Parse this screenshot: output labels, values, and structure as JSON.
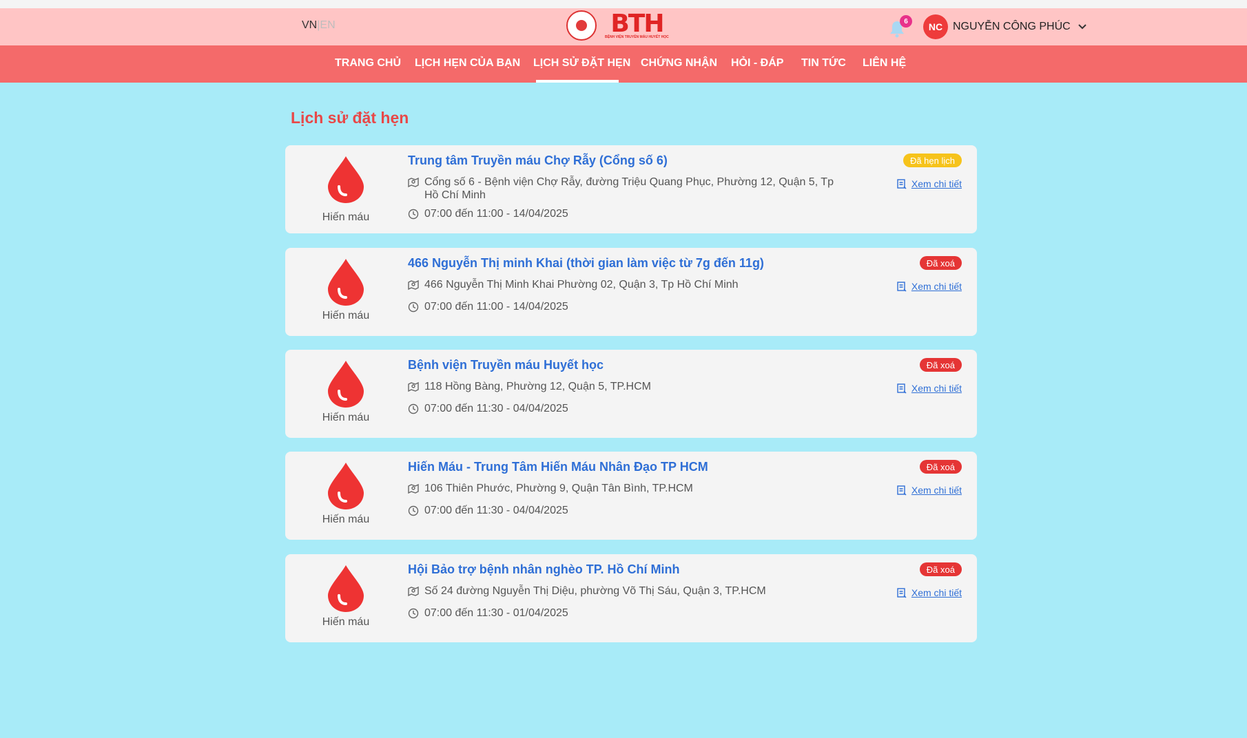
{
  "header": {
    "lang_active": "VN",
    "lang_sep": "|",
    "lang_inactive": "EN",
    "brand": "BTH",
    "brand_sub": "BỆNH VIỆN TRUYỀN MÁU HUYẾT HỌC",
    "notification_count": "6",
    "avatar_initials": "NC",
    "user_name": "NGUYỄN CÔNG PHÚC"
  },
  "nav": {
    "items": [
      "TRANG CHỦ",
      "LỊCH HẸN CỦA BẠN",
      "LỊCH SỬ ĐẶT HẸN",
      "CHỨNG NHẬN",
      "HỎI - ĐÁP",
      "TIN TỨC",
      "LIÊN HỆ"
    ],
    "active": "LỊCH SỬ ĐẶT HẸN"
  },
  "page": {
    "title": "Lịch sử đặt hẹn"
  },
  "appointments": [
    {
      "type_label": "Hiến máu",
      "title": "Trung tâm Truyền máu Chợ Rẫy (Cổng số 6)",
      "address": "Cổng số 6 - Bệnh viện Chợ Rẫy, đường Triệu Quang Phục, Phường 12, Quận 5, Tp Hồ Chí Minh",
      "time": "07:00 đến 11:00 - 14/04/2025",
      "status": "Đã hẹn lịch",
      "detail_label": "Xem chi tiết"
    },
    {
      "type_label": "Hiến máu",
      "title": "466 Nguyễn Thị minh Khai (thời gian làm việc từ 7g đến 11g)",
      "address": "466 Nguyễn Thị Minh Khai Phường 02, Quận 3, Tp Hồ Chí Minh",
      "time": "07:00 đến 11:00 - 14/04/2025",
      "status": "Đã xoá",
      "detail_label": "Xem chi tiết"
    },
    {
      "type_label": "Hiến máu",
      "title": "Bệnh viện Truyền máu Huyết học",
      "address": "118 Hồng Bàng, Phường 12, Quận 5, TP.HCM",
      "time": "07:00 đến 11:30 - 04/04/2025",
      "status": "Đã xoá",
      "detail_label": "Xem chi tiết"
    },
    {
      "type_label": "Hiến máu",
      "title": "Hiến Máu - Trung Tâm Hiến Máu Nhân Đạo TP HCM",
      "address": "106 Thiên Phước, Phường 9, Quận Tân Bình, TP.HCM",
      "time": "07:00 đến 11:30 - 04/04/2025",
      "status": "Đã xoá",
      "detail_label": "Xem chi tiết"
    },
    {
      "type_label": "Hiến máu",
      "title": "Hội Bảo trợ bệnh nhân nghèo TP. Hồ Chí Minh",
      "address": "Số 24 đường Nguyễn Thị Diệu, phường Võ Thị Sáu, Quận 3, TP.HCM",
      "time": "07:00 đến 11:30 - 01/04/2025",
      "status": "Đã xoá",
      "detail_label": "Xem chi tiết"
    }
  ],
  "colors": {
    "background": "#a8ebf8",
    "topbar": "#ffc5c5",
    "navbar": "#f46a6a",
    "title": "#e84848",
    "link": "#2f6fd6",
    "status_scheduled": "#f6c31b",
    "status_deleted": "#e53535",
    "drop": "#ee3333"
  }
}
